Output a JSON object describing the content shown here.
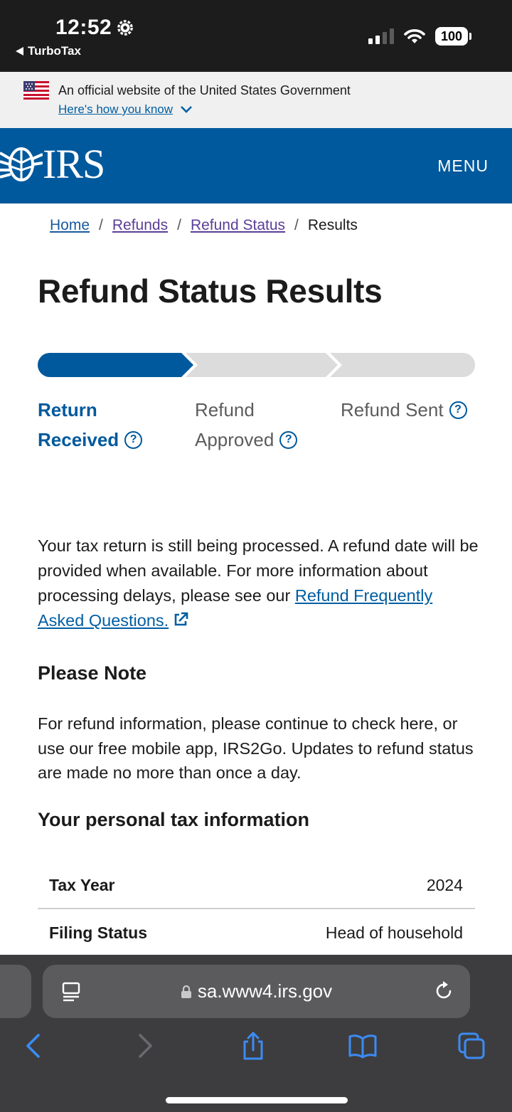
{
  "status_bar": {
    "time": "12:52",
    "back_app": "TurboTax",
    "battery": "100"
  },
  "gov_banner": {
    "text": "An official website of the United States Government",
    "link": "Here's how you know"
  },
  "header": {
    "logo": "IRS",
    "menu": "MENU"
  },
  "breadcrumb": [
    "Home",
    "Refunds",
    "Refund Status",
    "Results"
  ],
  "page_title": "Refund Status Results",
  "progress": {
    "steps": [
      {
        "line1": "Return",
        "line2": "Received"
      },
      {
        "line1": "Refund",
        "line2": "Approved"
      },
      {
        "line1": "Refund Sent",
        "line2": ""
      }
    ],
    "current_step": 1,
    "total_steps": 3,
    "colors": {
      "active": "#00599c",
      "inactive": "#dcdcdc"
    }
  },
  "status_message": {
    "text": "Your tax return is still being processed. A refund date will be provided when available. For more information about processing delays, please see our ",
    "link": "Refund Frequently Asked Questions."
  },
  "note": {
    "heading": "Please Note",
    "text": "For refund information, please continue to check here, or use our free mobile app, IRS2Go. Updates to refund status are made no more than once a day."
  },
  "personal_info": {
    "heading": "Your personal tax information",
    "rows": [
      {
        "label": "Tax Year",
        "value": "2024"
      },
      {
        "label": "Filing Status",
        "value": "Head of household"
      }
    ]
  },
  "browser": {
    "url": "sa.www4.irs.gov"
  }
}
